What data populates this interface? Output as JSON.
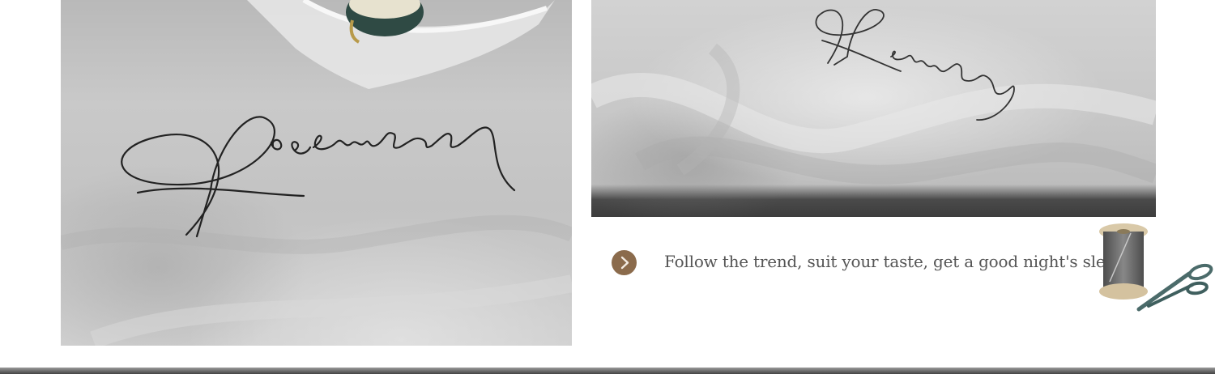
{
  "caption": {
    "text": "Follow the trend, suit your taste, get a good night's sleep",
    "icon": "chevron-right-icon"
  },
  "colors": {
    "bullet": "#8b6b4c",
    "caption_text": "#555555",
    "fabric": "#c6c6c6",
    "script": "#222222"
  },
  "icons": {
    "spool": "thread-spool-icon",
    "scissors": "scissors-icon"
  }
}
